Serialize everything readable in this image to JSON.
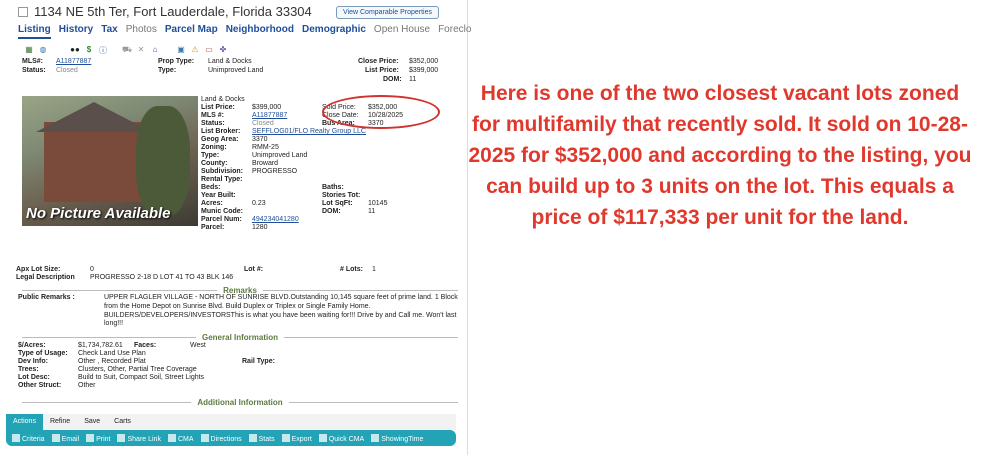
{
  "header": {
    "address": "1134 NE 5th Ter, Fort Lauderdale, Florida 33304",
    "compare_button": "View Comparable Properties"
  },
  "tabs": [
    "Listing",
    "History",
    "Tax",
    "Photos",
    "Parcel Map",
    "Neighborhood",
    "Demographic",
    "Open House",
    "Foreclo"
  ],
  "toprow": {
    "mls_label": "MLS#:",
    "mls_value": "A11877887",
    "status_label": "Status:",
    "status_value": "Closed",
    "prop_type_label": "Prop Type:",
    "prop_type_value": "Land & Docks",
    "type_label": "Type:",
    "type_value": "Unimproved Land",
    "close_price_label": "Close Price:",
    "close_price_value": "$352,000",
    "list_price_label": "List Price:",
    "list_price_value": "$399,000",
    "dom_label": "DOM:",
    "dom_value": "11"
  },
  "photo": {
    "overlay": "No Picture Available"
  },
  "details": {
    "category": "Land & Docks",
    "list_price_label": "List Price:",
    "list_price": "$399,000",
    "mls_label": "MLS #:",
    "mls": "A11877887",
    "status_label": "Status:",
    "status": "Closed",
    "broker_label": "List Broker:",
    "broker": "SEFFLOG01/FLO Realty Group LLC",
    "geog_label": "Geog Area:",
    "geog": "3370",
    "zoning_label": "Zoning:",
    "zoning": "RMM-25",
    "type_label": "Type:",
    "type": "Unimproved Land",
    "county_label": "County:",
    "county": "Broward",
    "subdiv_label": "Subdivision:",
    "subdiv": "PROGRESSO",
    "rental_label": "Rental Type:",
    "beds_label": "Beds:",
    "yearbuilt_label": "Year Built:",
    "acres_label": "Acres:",
    "acres": "0.23",
    "munic_label": "Munic Code:",
    "parcelnum_label": "Parcel Num:",
    "parcelnum": "494234041280",
    "parcel_label": "Parcel:",
    "parcel": "1280",
    "sold_price_label": "Sold Price:",
    "sold_price": "$352,000",
    "close_date_label": "Close Date:",
    "close_date": "10/28/2025",
    "bus_area_label": "Bus Area:",
    "bus_area": "3370",
    "baths_label": "Baths:",
    "stories_label": "Stories Tot:",
    "lotsqft_label": "Lot SqFt:",
    "lotsqft": "10145",
    "dom_label": "DOM:",
    "dom": "11"
  },
  "lot": {
    "apx_label": "Apx Lot Size:",
    "apx": "0",
    "lotno_label": "Lot #:",
    "lots_label": "# Lots:",
    "lots": "1",
    "legal_label": "Legal Description",
    "legal": "PROGRESSO 2-18 D LOT 41 TO 43 BLK 146"
  },
  "remarks": {
    "heading": "Remarks",
    "label": "Public Remarks :",
    "text": "UPPER FLAGLER VILLAGE - NORTH OF SUNRISE BLVD.Outstanding 10,145 square feet of prime land. 1 Block from the Home Depot on Sunrise Blvd. Build Duplex or Triplex or Single Family Home. BUILDERS/DEVELOPERS/INVESTORSThis is what you have been waiting for!!! Drive by and Call me. Won't last long!!!"
  },
  "general": {
    "heading": "General Information",
    "per_acre_label": "$/Acres:",
    "per_acre": "$1,734,782.61",
    "faces_label": "Faces:",
    "faces": "West",
    "usage_label": "Type of Usage:",
    "usage": "Check Land Use Plan",
    "dev_label": "Dev Info:",
    "dev": "Other , Recorded Plat",
    "rail_label": "Rail Type:",
    "trees_label": "Trees:",
    "trees": "Clusters, Other, Partial Tree Coverage",
    "lotdesc_label": "Lot Desc:",
    "lotdesc": "Build to Suit, Compact Soil, Street Lights",
    "otherstruct_label": "Other Struct:",
    "otherstruct": "Other"
  },
  "additional": {
    "heading": "Additional Information"
  },
  "toolbar": {
    "tabs": [
      "Actions",
      "Refine",
      "Save",
      "Carts"
    ],
    "buttons": [
      "Criteria",
      "Email",
      "Print",
      "Share Link",
      "CMA",
      "Directions",
      "Stats",
      "Export",
      "Quick CMA",
      "ShowingTime"
    ]
  },
  "callout": "Here is one of the two closest vacant lots zoned for multifamily that recently sold. It sold on 10-28-2025 for $352,000 and according to the listing, you can build up to 3 units on the lot. This equals a price of $117,333 per unit for the land.",
  "colors": {
    "link": "#1f4e9a",
    "section_heading": "#5b7a3f",
    "toolbar": "#22a3b6",
    "callout": "#e0382d",
    "annotation_oval": "#d2322d"
  }
}
